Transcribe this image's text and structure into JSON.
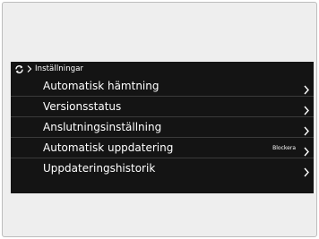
{
  "header": {
    "breadcrumb": "Inställningar"
  },
  "menu": {
    "items": [
      {
        "label": "Automatisk hämtning",
        "badge": ""
      },
      {
        "label": "Versionsstatus",
        "badge": ""
      },
      {
        "label": "Anslutningsinställning",
        "badge": ""
      },
      {
        "label": "Automatisk uppdatering",
        "badge": "Blockera"
      },
      {
        "label": "Uppdateringshistorik",
        "badge": ""
      }
    ]
  },
  "icons": {
    "header": [
      "refresh-icon",
      "breadcrumb-separator-icon"
    ],
    "row": "chevron-right-icon"
  },
  "colors": {
    "screen_background": "#141414",
    "text": "#ffffff",
    "divider": "#3a3a3a",
    "frame_background": "#eeeeee"
  }
}
